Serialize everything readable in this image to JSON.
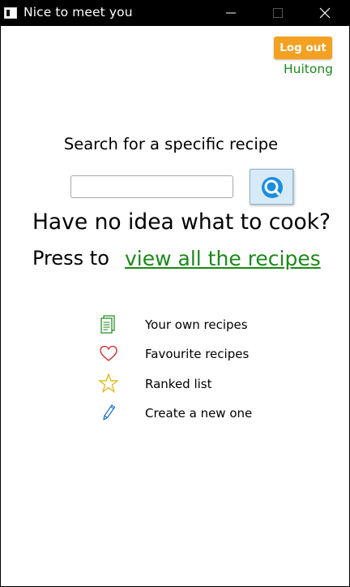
{
  "window": {
    "title": "Nice to meet you",
    "icons": [
      "app-icon",
      "minimize-icon",
      "maximize-icon",
      "close-icon"
    ]
  },
  "header": {
    "logout_label": "Log out",
    "username": "Huitong",
    "logout_color": "#f4a020",
    "username_color": "#1a8a1a"
  },
  "search": {
    "heading": "Search for a specific recipe",
    "input_value": "",
    "button_icon": "search-icon",
    "button_color": "#d7eaf8"
  },
  "browse": {
    "question": "Have no idea what to cook?",
    "prompt": "Press to",
    "link_label": "view all the recipes",
    "link_color": "#1a8a1a"
  },
  "menu": {
    "items": [
      {
        "label": "Your own recipes",
        "icon": "notebook-icon",
        "color": "#1a8a1a"
      },
      {
        "label": "Favourite recipes",
        "icon": "heart-icon",
        "color": "#d42020"
      },
      {
        "label": "Ranked list",
        "icon": "star-icon",
        "color": "#e0b400"
      },
      {
        "label": "Create a new one",
        "icon": "pencil-icon",
        "color": "#1a6ac8"
      }
    ]
  }
}
